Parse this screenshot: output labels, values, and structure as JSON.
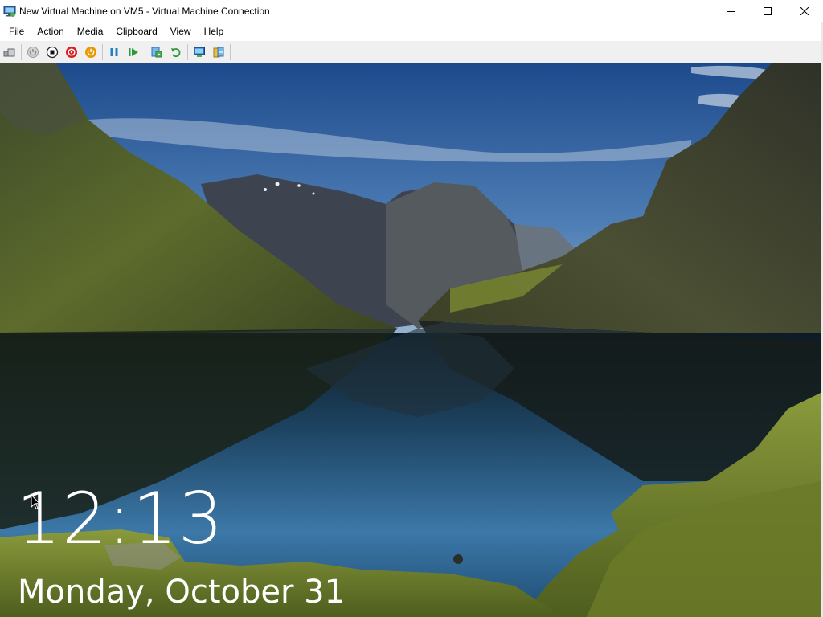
{
  "window": {
    "title": "New Virtual Machine on VM5 - Virtual Machine Connection",
    "icon": "vm-connection-icon",
    "controls": [
      "minimize-icon",
      "maximize-icon",
      "close-icon"
    ]
  },
  "menu": {
    "items": [
      {
        "label": "File"
      },
      {
        "label": "Action"
      },
      {
        "label": "Media"
      },
      {
        "label": "Clipboard"
      },
      {
        "label": "View"
      },
      {
        "label": "Help"
      }
    ]
  },
  "toolbar": {
    "buttons": [
      "ctrl-alt-del-icon",
      "start-icon",
      "turn-off-icon",
      "shut-down-icon",
      "save-icon",
      "pause-icon",
      "resume-icon",
      "checkpoint-icon",
      "revert-icon",
      "enhanced-session-icon",
      "share-icon"
    ]
  },
  "lockscreen": {
    "time": "12:13",
    "date": "Monday, October 31"
  },
  "colors": {
    "titlebar_bg": "#ffffff",
    "toolbar_bg": "#f0f0f0",
    "sky_top": "#1f4e8f",
    "water": "#2a5f8c",
    "moss": "#6b7a2a",
    "stop_red": "#d81e1e",
    "power_orange": "#e69a00",
    "accent_blue": "#1e7fc9",
    "accent_green": "#2c9a3a"
  }
}
